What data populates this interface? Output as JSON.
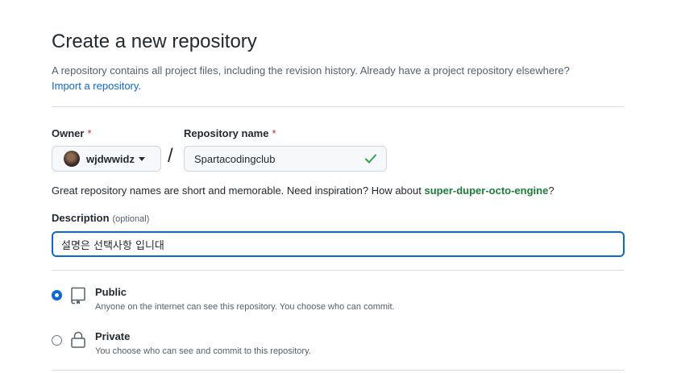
{
  "header": {
    "title": "Create a new repository",
    "subtitle": "A repository contains all project files, including the revision history. Already have a project repository elsewhere?",
    "import_link": "Import a repository."
  },
  "owner": {
    "label": "Owner",
    "required_mark": "*",
    "value": "wjdwwidz"
  },
  "separator": "/",
  "repo_name": {
    "label": "Repository name",
    "required_mark": "*",
    "value": "Spartacodingclub"
  },
  "hint": {
    "text": "Great repository names are short and memorable. Need inspiration? How about",
    "suggestion": "super-duper-octo-engine",
    "end": "?"
  },
  "description": {
    "label": "Description",
    "optional": "(optional)",
    "value": "설명은 선택사항 입니대"
  },
  "visibility": {
    "selected": "Public",
    "public": {
      "title": "Public",
      "desc": "Anyone on the internet can see this repository. You choose who can commit."
    },
    "private": {
      "title": "Private",
      "desc": "You choose who can see and commit to this repository."
    }
  },
  "colors": {
    "accent": "#0969da",
    "success": "#1a7f37",
    "required": "#cf222e"
  }
}
